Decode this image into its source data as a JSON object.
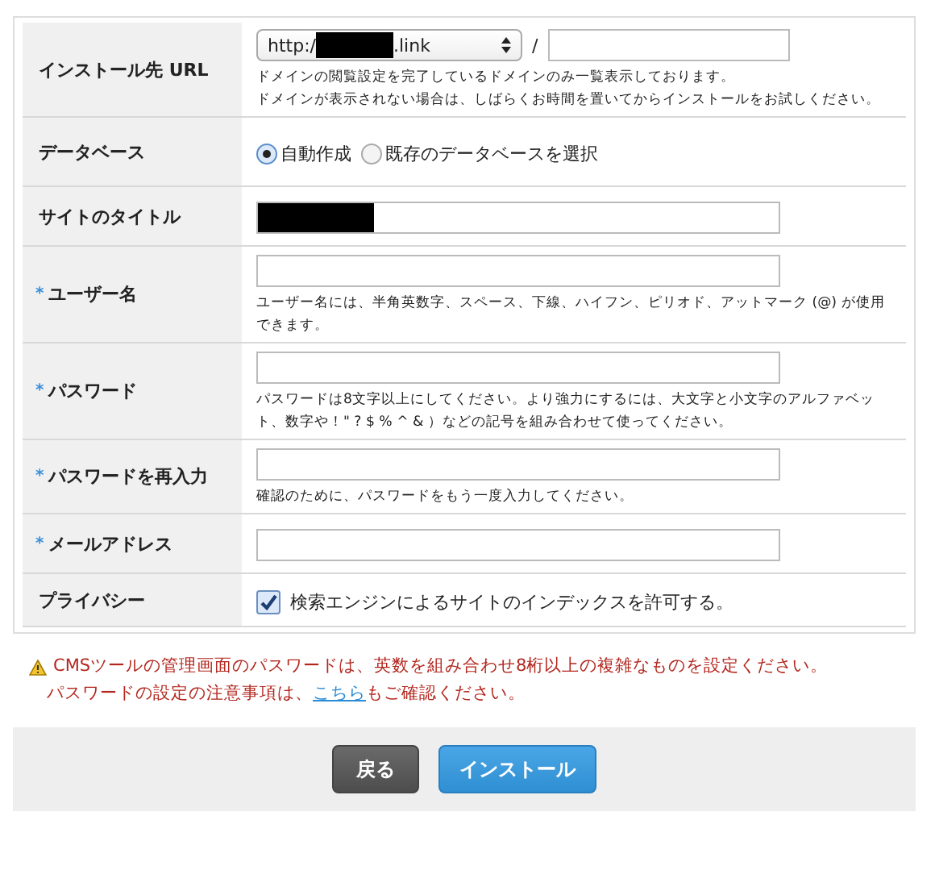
{
  "form_rows": [
    {
      "kind": "url",
      "label": "インストール先 URL",
      "required": false,
      "select": {
        "prefix": "http:/",
        "suffix": ".link",
        "redacted": true
      },
      "separator": "/",
      "hints": [
        "ドメインの閲覧設定を完了しているドメインのみ一覧表示しております。",
        "ドメインが表示されない場合は、しばらくお時間を置いてからインストールをお試しください。"
      ]
    },
    {
      "kind": "radio",
      "label": "データベース",
      "required": false,
      "options": [
        {
          "label": "自動作成",
          "selected": true
        },
        {
          "label": "既存のデータベースを選択",
          "selected": false
        }
      ]
    },
    {
      "kind": "text",
      "label": "サイトのタイトル",
      "required": false,
      "redacted": true
    },
    {
      "kind": "text",
      "label": "ユーザー名",
      "required": true,
      "redacted": false,
      "hints": [
        "ユーザー名には、半角英数字、スペース、下線、ハイフン、ピリオド、アットマーク (@) が使用できます。"
      ]
    },
    {
      "kind": "text",
      "label": "パスワード",
      "required": true,
      "redacted": false,
      "hints": [
        "パスワードは8文字以上にしてください。より強力にするには、大文字と小文字のアルファベット、数字や！\" ? $ % ^ & ）などの記号を組み合わせて使ってください。"
      ]
    },
    {
      "kind": "text",
      "label": "パスワードを再入力",
      "required": true,
      "redacted": false,
      "hints": [
        "確認のために、パスワードをもう一度入力してください。"
      ]
    },
    {
      "kind": "text",
      "label": "メールアドレス",
      "required": true,
      "redacted": false
    },
    {
      "kind": "checkbox",
      "label": "プライバシー",
      "required": false,
      "option": {
        "label": "検索エンジンによるサイトのインデックスを許可する。",
        "checked": true
      }
    }
  ],
  "required_mark": "*",
  "warning": {
    "line_1": "CMSツールの管理画面のパスワードは、英数を組み合わせ8桁以上の複雑なものを設定ください。",
    "line_2_before": "パスワードの設定の注意事項は、",
    "link": "こちら",
    "line_2_after": "もご確認ください。"
  },
  "buttons": [
    {
      "kind": "secondary",
      "label": "戻る"
    },
    {
      "kind": "primary",
      "label": "インストール"
    }
  ]
}
